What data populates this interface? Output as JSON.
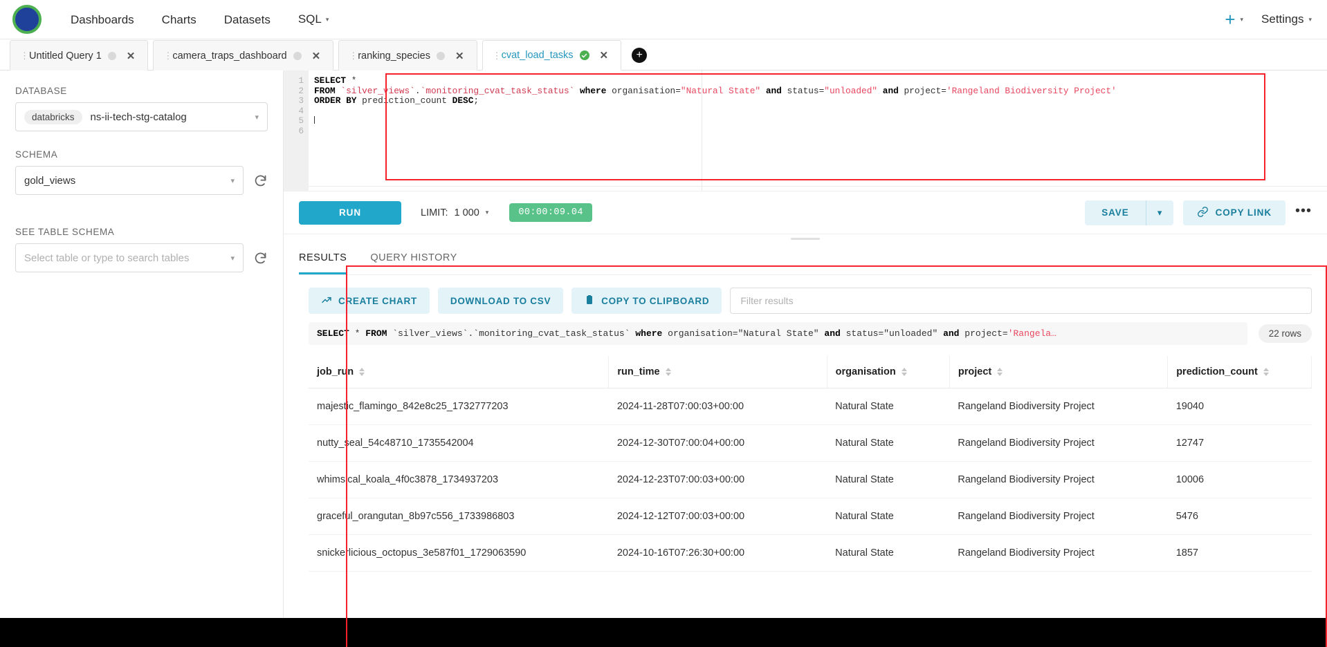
{
  "navbar": {
    "logo_name": "superset-logo",
    "links": [
      {
        "label": "Dashboards",
        "has_caret": false
      },
      {
        "label": "Charts",
        "has_caret": false
      },
      {
        "label": "Datasets",
        "has_caret": false
      },
      {
        "label": "SQL",
        "has_caret": true
      }
    ],
    "plus_label": "+",
    "settings_label": "Settings",
    "caret": "▾"
  },
  "tabs": [
    {
      "label": "Untitled Query 1",
      "state": "idle",
      "active": false
    },
    {
      "label": "camera_traps_dashboard",
      "state": "idle",
      "active": false
    },
    {
      "label": "ranking_species",
      "state": "idle",
      "active": false
    },
    {
      "label": "cvat_load_tasks",
      "state": "success",
      "active": true
    }
  ],
  "tab_add_label": "+",
  "tab_close_label": "✕",
  "sidebar": {
    "database_label": "DATABASE",
    "database_engine_chip": "databricks",
    "database_value": "ns-ii-tech-stg-catalog",
    "schema_label": "SCHEMA",
    "schema_value": "gold_views",
    "table_schema_label": "SEE TABLE SCHEMA",
    "table_schema_placeholder": "Select table or type to search tables"
  },
  "editor": {
    "line_numbers": [
      "1",
      "2",
      "3",
      "4",
      "5",
      "6"
    ],
    "sql_lines": [
      [
        {
          "t": "SELECT",
          "c": "kw"
        },
        {
          "t": " *",
          "c": "plain"
        }
      ],
      [
        {
          "t": "FROM",
          "c": "kw"
        },
        {
          "t": " ",
          "c": "plain"
        },
        {
          "t": "`silver_views`",
          "c": "ident"
        },
        {
          "t": ".",
          "c": "plain"
        },
        {
          "t": "`monitoring_cvat_task_status`",
          "c": "ident"
        },
        {
          "t": " ",
          "c": "plain"
        },
        {
          "t": "where",
          "c": "kw"
        },
        {
          "t": " organisation=",
          "c": "plain"
        },
        {
          "t": "\"Natural State\"",
          "c": "str"
        },
        {
          "t": " ",
          "c": "plain"
        },
        {
          "t": "and",
          "c": "kw"
        },
        {
          "t": " status=",
          "c": "plain"
        },
        {
          "t": "\"unloaded\"",
          "c": "str"
        },
        {
          "t": " ",
          "c": "plain"
        },
        {
          "t": "and",
          "c": "kw"
        },
        {
          "t": " project=",
          "c": "plain"
        },
        {
          "t": "'Rangeland Biodiversity Project'",
          "c": "str"
        }
      ],
      [
        {
          "t": "ORDER BY",
          "c": "kw"
        },
        {
          "t": " prediction_count ",
          "c": "plain"
        },
        {
          "t": "DESC",
          "c": "kw"
        },
        {
          "t": ";",
          "c": "plain"
        }
      ],
      [],
      [],
      []
    ],
    "cursor_line": 5
  },
  "runbar": {
    "run_label": "RUN",
    "limit_label": "LIMIT:",
    "limit_value": "1 000",
    "timer": "00:00:09.04",
    "save_label": "SAVE",
    "copy_link_label": "COPY LINK",
    "more_label": "•••",
    "caret": "⌄"
  },
  "results": {
    "tabs": [
      {
        "label": "RESULTS",
        "active": true
      },
      {
        "label": "QUERY HISTORY",
        "active": false
      }
    ],
    "actions": [
      {
        "label": "CREATE CHART",
        "icon": "chart-icon"
      },
      {
        "label": "DOWNLOAD TO CSV",
        "icon": null
      },
      {
        "label": "COPY TO CLIPBOARD",
        "icon": "clipboard-icon"
      }
    ],
    "filter_placeholder": "Filter results",
    "sql_preview": [
      {
        "t": "SELECT",
        "c": "kw"
      },
      {
        "t": " * ",
        "c": "plain"
      },
      {
        "t": "FROM",
        "c": "kw"
      },
      {
        "t": " ",
        "c": "plain"
      },
      {
        "t": "`silver_views`",
        "c": "plain"
      },
      {
        "t": ".",
        "c": "plain"
      },
      {
        "t": "`monitoring_cvat_task_status`",
        "c": "plain"
      },
      {
        "t": " ",
        "c": "plain"
      },
      {
        "t": "where",
        "c": "kw"
      },
      {
        "t": " organisation=",
        "c": "plain"
      },
      {
        "t": "\"Natural State\"",
        "c": "plain"
      },
      {
        "t": " ",
        "c": "plain"
      },
      {
        "t": "and",
        "c": "kw"
      },
      {
        "t": " status=",
        "c": "plain"
      },
      {
        "t": "\"unloaded\"",
        "c": "plain"
      },
      {
        "t": " ",
        "c": "plain"
      },
      {
        "t": "and",
        "c": "kw"
      },
      {
        "t": " project=",
        "c": "plain"
      },
      {
        "t": "'Rangela…",
        "c": "str"
      }
    ],
    "row_count": "22 rows",
    "columns": [
      "job_run",
      "run_time",
      "organisation",
      "project",
      "prediction_count"
    ],
    "rows": [
      [
        "majestic_flamingo_842e8c25_1732777203",
        "2024-11-28T07:00:03+00:00",
        "Natural State",
        "Rangeland Biodiversity Project",
        "19040"
      ],
      [
        "nutty_seal_54c48710_1735542004",
        "2024-12-30T07:00:04+00:00",
        "Natural State",
        "Rangeland Biodiversity Project",
        "12747"
      ],
      [
        "whimsical_koala_4f0c3878_1734937203",
        "2024-12-23T07:00:03+00:00",
        "Natural State",
        "Rangeland Biodiversity Project",
        "10006"
      ],
      [
        "graceful_orangutan_8b97c556_1733986803",
        "2024-12-12T07:00:03+00:00",
        "Natural State",
        "Rangeland Biodiversity Project",
        "5476"
      ],
      [
        "snickerlicious_octopus_3e587f01_1729063590",
        "2024-10-16T07:26:30+00:00",
        "Natural State",
        "Rangeland Biodiversity Project",
        "1857"
      ]
    ]
  },
  "colors": {
    "accent": "#20a7c9",
    "accent_soft": "#e3f3f8",
    "success": "#59c289",
    "annotation": "#f5222d",
    "sql_string": "#e8475f",
    "sql_ident": "#d13b52"
  }
}
